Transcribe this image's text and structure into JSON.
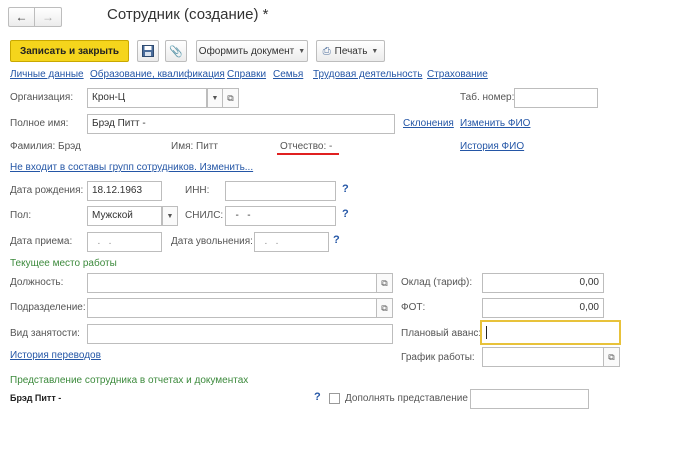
{
  "window": {
    "title": "Сотрудник (создание) *"
  },
  "toolbar": {
    "save_close_label": "Записать и закрыть",
    "save_icon": "floppy-icon",
    "attach_icon": "paperclip-icon",
    "issue_doc_label": "Оформить документ",
    "print_label": "Печать"
  },
  "nav_links": [
    "Личные данные",
    "Образование, квалификация",
    "Справки",
    "Семья",
    "Трудовая деятельность",
    "Страхование"
  ],
  "form": {
    "org_label": "Организация:",
    "org_value": "Крон-Ц",
    "tab_number_label": "Таб. номер:",
    "tab_number_value": "",
    "full_name_label": "Полное имя:",
    "full_name_value": "Брэд Питт -",
    "declensions_link": "Склонения",
    "change_fio_link": "Изменить ФИО",
    "surname_text": "Фамилия: Брэд",
    "name_text": "Имя: Питт",
    "patronymic_text": "Отчество: -",
    "fio_history_link": "История ФИО",
    "groups_link": "Не входит в составы групп сотрудников. Изменить...",
    "birth_date_label": "Дата рождения:",
    "birth_date_value": "18.12.1963",
    "inn_label": "ИНН:",
    "inn_value": "",
    "gender_label": "Пол:",
    "gender_value": "Мужской",
    "snils_label": "СНИЛС:",
    "snils_value": "  -   -",
    "hire_date_label": "Дата приема:",
    "hire_date_value": "  .   .",
    "dismissal_label": "Дата увольнения:",
    "dismissal_value": "  .   .",
    "question_mark": "?"
  },
  "workplace": {
    "section_title": "Текущее место работы",
    "position_label": "Должность:",
    "position_value": "",
    "department_label": "Подразделение:",
    "department_value": "",
    "employment_label": "Вид занятости:",
    "employment_value": "",
    "salary_label": "Оклад (тариф):",
    "salary_value": "0,00",
    "fot_label": "ФОТ:",
    "fot_value": "0,00",
    "advance_label": "Плановый аванс:",
    "advance_value": "",
    "schedule_label": "График работы:",
    "schedule_value": "",
    "transfers_link": "История переводов"
  },
  "presentation": {
    "section_title": "Представление сотрудника в отчетах и документах",
    "value": "Брэд Питт -",
    "checkbox_label": "Дополнять представление",
    "checked": false,
    "extra_value": ""
  },
  "colors": {
    "primary_button": "#f5d51c",
    "link": "#2456a6",
    "section": "#3c8a3c",
    "underline": "#e02020",
    "focus": "#e8c23a"
  }
}
